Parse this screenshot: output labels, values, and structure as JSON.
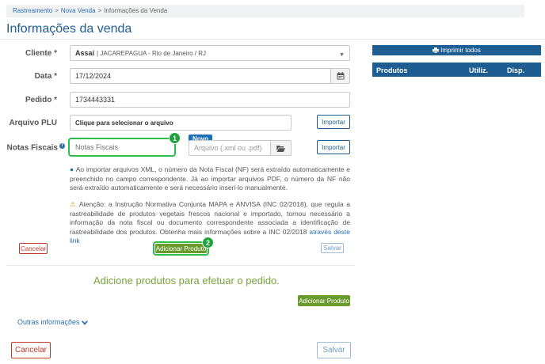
{
  "breadcrumb": {
    "items": [
      "Rastreamento",
      "Nova Venda",
      "Informações da Venda"
    ],
    "separator": ">"
  },
  "page": {
    "title": "Informações da venda"
  },
  "form": {
    "cliente": {
      "label": "Cliente",
      "required_mark": "*",
      "name": "Assaí",
      "detail": "| JACAREPAGUA - Rio de Janeiro / RJ"
    },
    "data": {
      "label": "Data",
      "required_mark": "*",
      "value": "17/12/2024"
    },
    "pedido": {
      "label": "Pedido",
      "required_mark": "*",
      "value": "1734443331"
    },
    "arquivo_plu": {
      "label": "Arquivo PLU",
      "placeholder": "Clique para selecionar o arquivo",
      "import_label": "Importar"
    },
    "notas_fiscais": {
      "label": "Notas Fiscais",
      "placeholder": "Notas Fiscais",
      "file_placeholder": "Arquivo (.xml ou .pdf)",
      "badge": "Novo",
      "import_label": "Importar",
      "step_number": "1"
    },
    "info_xml": "Ao importar arquivos XML, o número da Nota Fiscal (NF) será extraído automaticamente e preenchido no campo correspondente. Já ao importar arquivos PDF, o número da NF não será extraído automaticamente e será necessário inseri-lo manualmente.",
    "warning_text": "Atenção: a Instrução Normativa Conjunta MAPA e ANVISA (INC 02/2018), que regula a rastreabilidade de produtos vegetais frescos nacional e importado, tornou necessário a informação da nota fiscal ou documento correspondente associada a identificação de rastreabilidade dos produtos. Obtenha mais informações sobre a INC 02/2018",
    "warning_link": "através deste link"
  },
  "actions": {
    "cancel_small": "Cancelar",
    "add_product": "Adicionar Produto",
    "add_product_step": "2",
    "save_small": "Salvar"
  },
  "products": {
    "empty_message": "Adicione produtos para efetuar o pedido.",
    "add_product": "Adicionar Produto"
  },
  "outros": {
    "label": "Outras informações"
  },
  "footer": {
    "cancel": "Cancelar",
    "save": "Salvar"
  },
  "side_panel": {
    "print_label": "Imprimir todos",
    "columns": [
      "Produtos",
      "Utiliz.",
      "Disp."
    ]
  },
  "colors": {
    "primary": "#1d5d92",
    "accent_green": "#6a9a2c",
    "highlight": "#2cbf4a",
    "danger": "#c0392b"
  },
  "icons": [
    "calendar-icon",
    "folder-open-icon",
    "info-icon",
    "warning-icon",
    "chevron-down-icon",
    "print-icon",
    "caret-down-icon"
  ]
}
